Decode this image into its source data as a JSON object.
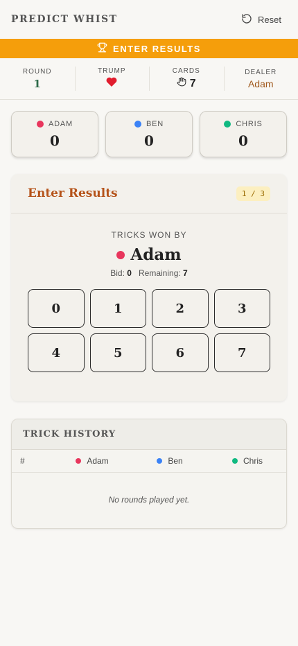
{
  "header": {
    "title": "PREDICT WHIST",
    "reset_label": "Reset"
  },
  "banner": {
    "label": "ENTER RESULTS",
    "color": "#f59e0b"
  },
  "info": {
    "round_label": "ROUND",
    "round_value": "1",
    "trump_label": "TRUMP",
    "trump_suit": "hearts",
    "cards_label": "CARDS",
    "cards_value": "7",
    "dealer_label": "DEALER",
    "dealer_value": "Adam"
  },
  "players": [
    {
      "name": "ADAM",
      "score": "0",
      "color": "#e8365d"
    },
    {
      "name": "BEN",
      "score": "0",
      "color": "#3b82f6"
    },
    {
      "name": "CHRIS",
      "score": "0",
      "color": "#10b981"
    }
  ],
  "results": {
    "title": "Enter Results",
    "progress": "1 / 3",
    "tricks_label": "TRICKS WON BY",
    "current_player": "Adam",
    "current_color": "#e8365d",
    "bid_label": "Bid:",
    "bid_value": "0",
    "remaining_label": "Remaining:",
    "remaining_value": "7",
    "options": [
      "0",
      "1",
      "2",
      "3",
      "4",
      "5",
      "6",
      "7"
    ]
  },
  "history": {
    "title": "TRICK HISTORY",
    "col_hash": "#",
    "columns": [
      "Adam",
      "Ben",
      "Chris"
    ],
    "empty_text": "No rounds played yet."
  }
}
